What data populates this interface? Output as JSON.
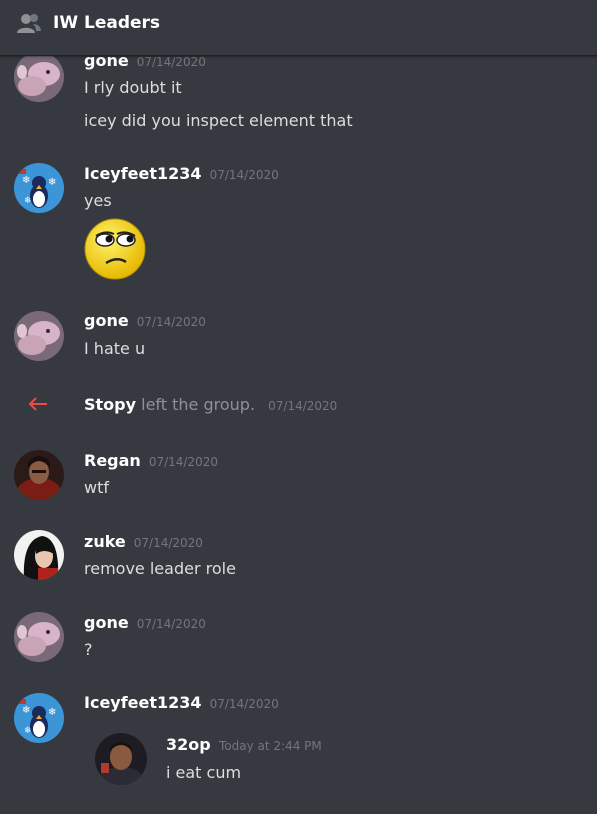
{
  "header": {
    "title": "IW Leaders",
    "icon": "group-members-icon"
  },
  "messages": [
    {
      "author": "gone",
      "time": "07/14/2020",
      "lines": [
        "I rly doubt it",
        "icey did you inspect element that"
      ]
    },
    {
      "author": "Iceyfeet1234",
      "time": "07/14/2020",
      "lines": [
        "yes"
      ],
      "emoji": "rolling-eyes-face-emoji"
    },
    {
      "author": "gone",
      "time": "07/14/2020",
      "lines": [
        "I hate u"
      ]
    },
    {
      "author": "Regan",
      "time": "07/14/2020",
      "lines": [
        "wtf"
      ]
    },
    {
      "author": "zuke",
      "time": "07/14/2020",
      "lines": [
        "remove leader role"
      ]
    },
    {
      "author": "gone",
      "time": "07/14/2020",
      "lines": [
        "?"
      ]
    },
    {
      "author": "Iceyfeet1234",
      "time": "07/14/2020",
      "lines": []
    }
  ],
  "system": {
    "user": "Stopy",
    "action": "left the group.",
    "time": "07/14/2020",
    "icon": "leave-arrow-icon"
  },
  "embedded_quote": {
    "author": "32op",
    "time": "Today at 2:44 PM",
    "text": "i eat cum"
  },
  "colors": {
    "background": "#36393f",
    "timestamp": "#72767d",
    "leave_arrow": "#f04747"
  }
}
